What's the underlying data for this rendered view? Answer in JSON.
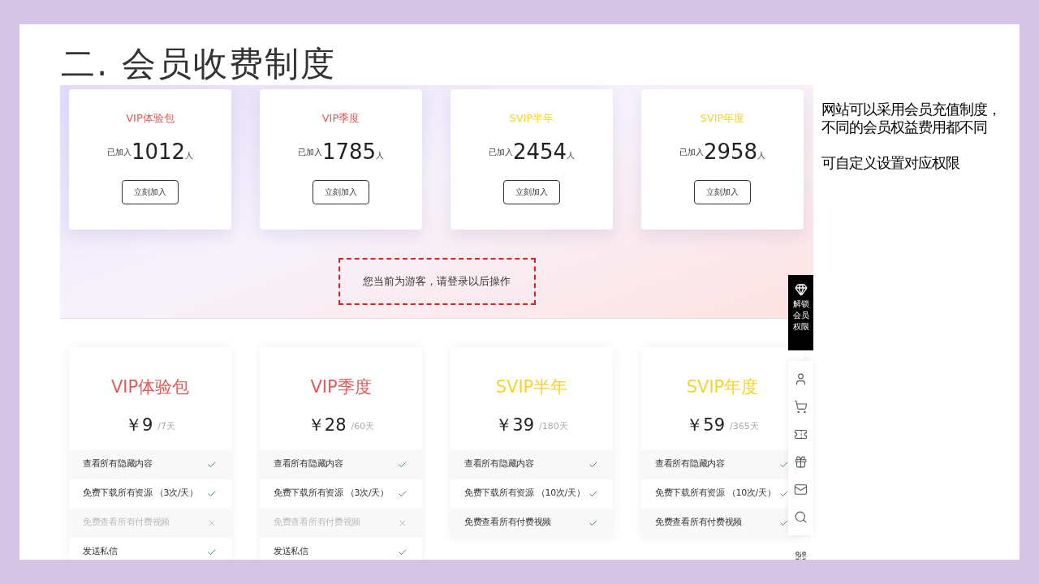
{
  "slide": {
    "title": "二. 会员收费制度",
    "notes": [
      [
        "网站可以采用会员充值制度，",
        "不同的会员权益费用都不同"
      ],
      [
        "可自定义设置对应权限"
      ]
    ]
  },
  "summary_cards": [
    {
      "name": "VIP体验包",
      "color": "#e05a5a",
      "prefix": "已加入",
      "count": "1012",
      "suffix": "人",
      "button": "立刻加入"
    },
    {
      "name": "VIP季度",
      "color": "#e05a5a",
      "prefix": "已加入",
      "count": "1785",
      "suffix": "人",
      "button": "立刻加入"
    },
    {
      "name": "SVIP半年",
      "color": "#f5d328",
      "prefix": "已加入",
      "count": "2454",
      "suffix": "人",
      "button": "立刻加入"
    },
    {
      "name": "SVIP年度",
      "color": "#f5d328",
      "prefix": "已加入",
      "count": "2958",
      "suffix": "人",
      "button": "立刻加入"
    }
  ],
  "notice": "您当前为游客，请登录以后操作",
  "plans": [
    {
      "name": "VIP体验包",
      "color": "#e05a5a",
      "price": "￥9",
      "period": "/7天",
      "features": [
        {
          "text": "查看所有隐藏内容",
          "included": true
        },
        {
          "text": "免费下载所有资源 （3次/天）",
          "included": true
        },
        {
          "text": "免费查看所有付费视频",
          "included": false
        },
        {
          "text": "发送私信",
          "included": true
        }
      ]
    },
    {
      "name": "VIP季度",
      "color": "#e05a5a",
      "price": "￥28",
      "period": "/60天",
      "features": [
        {
          "text": "查看所有隐藏内容",
          "included": true
        },
        {
          "text": "免费下载所有资源 （3次/天）",
          "included": true
        },
        {
          "text": "免费查看所有付费视频",
          "included": false
        },
        {
          "text": "发送私信",
          "included": true
        }
      ]
    },
    {
      "name": "SVIP半年",
      "color": "#f5d328",
      "price": "￥39",
      "period": "/180天",
      "features": [
        {
          "text": "查看所有隐藏内容",
          "included": true
        },
        {
          "text": "免费下载所有资源 （10次/天）",
          "included": true
        },
        {
          "text": "免费查看所有付费视频",
          "included": true
        }
      ]
    },
    {
      "name": "SVIP年度",
      "color": "#f5d328",
      "price": "￥59",
      "period": "/365天",
      "features": [
        {
          "text": "查看所有隐藏内容",
          "included": true
        },
        {
          "text": "免费下载所有资源 （10次/天）",
          "included": true
        },
        {
          "text": "免费查看所有付费视频",
          "included": true
        }
      ]
    }
  ],
  "float_bar": {
    "unlock": "解锁会员权限"
  }
}
